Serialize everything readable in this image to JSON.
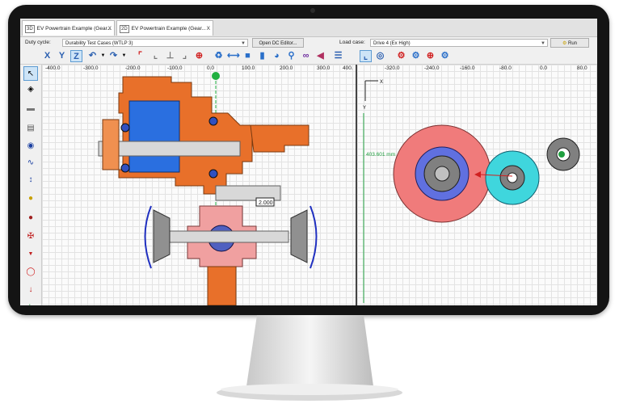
{
  "tabs": [
    {
      "badge": "3D",
      "label": "EV Powertrain Example (Gear...",
      "close": "X"
    },
    {
      "badge": "2D",
      "label": "EV Powertrain Example (Gear...",
      "close": "X"
    }
  ],
  "duty_cycle": {
    "label": "Duty cycle:",
    "value": "Durability Test Cases (WTLP 3)",
    "open_button": "Open DC Editor..."
  },
  "load_case": {
    "label": "Load case:",
    "value": "Drive 4 (Ex High)"
  },
  "run_button": "Run",
  "axis_buttons": [
    "X",
    "Y",
    "Z"
  ],
  "left_ruler": [
    "-400.0",
    "-300.0",
    "-200.0",
    "-100.0",
    "0.0",
    "100.0",
    "200.0",
    "300.0",
    "400."
  ],
  "right_ruler": [
    "-320.0",
    "-240.0",
    "-160.0",
    "-80.0",
    "0.0",
    "80.0"
  ],
  "dimension_label": "403.601 mm",
  "dimension_tag": "2.000",
  "right_axes": {
    "x": "X",
    "y": "Y"
  },
  "colors": {
    "accent": "#5d9bd2",
    "housing": "#e8702a",
    "rotor": "#2a6fe0",
    "gear_red": "#f07b7b",
    "gear_cyan": "#3fd6dd",
    "gear_grey": "#808080"
  }
}
